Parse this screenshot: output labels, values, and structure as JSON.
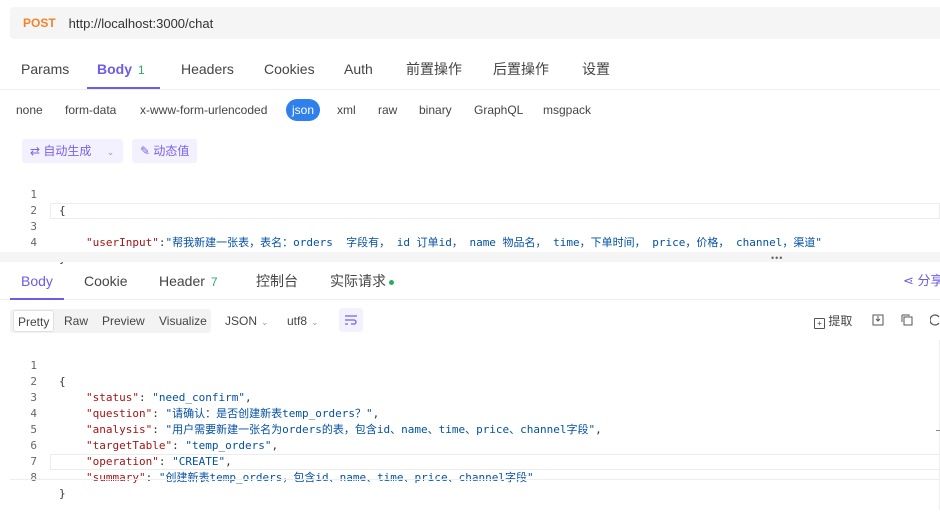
{
  "url_bar": {
    "method": "POST",
    "url": "http://localhost:3000/chat"
  },
  "request_tabs": [
    {
      "label": "Params"
    },
    {
      "label": "Body",
      "count": "1"
    },
    {
      "label": "Headers"
    },
    {
      "label": "Cookies"
    },
    {
      "label": "Auth"
    },
    {
      "label": "前置操作"
    },
    {
      "label": "后置操作"
    },
    {
      "label": "设置"
    }
  ],
  "body_types": [
    "none",
    "form-data",
    "x-www-form-urlencoded",
    "json",
    "xml",
    "raw",
    "binary",
    "GraphQL",
    "msgpack"
  ],
  "auto_generate_label": "自动生成",
  "dynamic_value_label": "动态值",
  "request_body": {
    "line_numbers": [
      "1",
      "2",
      "3",
      "4"
    ],
    "open": "{",
    "key": "\"userInput\"",
    "colon": ":",
    "value": "\"帮我新建一张表，表名：orders  字段有， id 订单id， name 物品名， time，下单时间， price，价格， channel，渠道\"",
    "close": "}"
  },
  "response_tabs": [
    {
      "label": "Body"
    },
    {
      "label": "Cookie"
    },
    {
      "label": "Header",
      "count": "7"
    },
    {
      "label": "控制台"
    },
    {
      "label": "实际请求"
    }
  ],
  "share_label": "分享",
  "format_buttons": [
    "Pretty",
    "Raw",
    "Preview",
    "Visualize"
  ],
  "format_select": "JSON",
  "encoding_select": "utf8",
  "extract_label": "提取",
  "colors": {
    "accent": "#6c5ce7",
    "method": "#f5822a",
    "json_chip": "#2f80ed",
    "count": "#27ae60"
  },
  "response_body": {
    "line_numbers": [
      "1",
      "2",
      "3",
      "4",
      "5",
      "6",
      "7",
      "8"
    ],
    "open": "{",
    "rows": [
      {
        "key": "\"status\"",
        "value": "\"need_confirm\"",
        "tail": ","
      },
      {
        "key": "\"question\"",
        "value": "\"请确认：是否创建新表temp_orders？\"",
        "tail": ","
      },
      {
        "key": "\"analysis\"",
        "value": "\"用户需要新建一张名为orders的表，包含id、name、time、price、channel字段\"",
        "tail": ","
      },
      {
        "key": "\"targetTable\"",
        "value": "\"temp_orders\"",
        "tail": ","
      },
      {
        "key": "\"operation\"",
        "value": "\"CREATE\"",
        "tail": ","
      },
      {
        "key": "\"summary\"",
        "value": "\"创建新表temp_orders，包含id、name、time、price、channel字段\"",
        "tail": ""
      }
    ],
    "close": "}"
  }
}
